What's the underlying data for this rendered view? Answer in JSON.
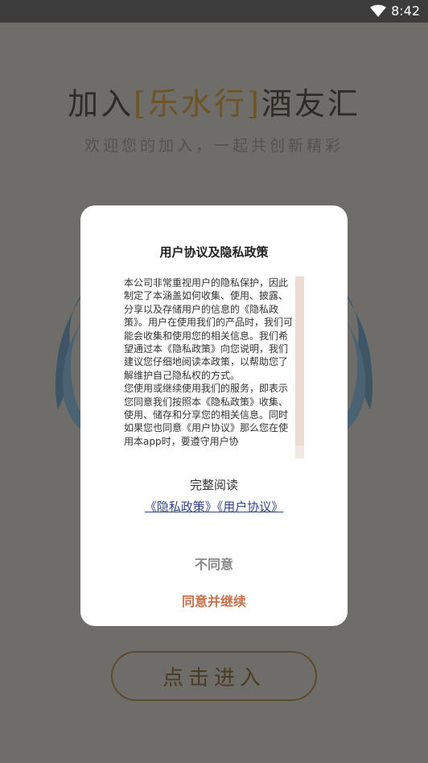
{
  "status_bar": {
    "time": "8:42"
  },
  "background": {
    "title_prefix": "加入",
    "bracket_open": "[",
    "brand": "乐水行",
    "bracket_close": "]",
    "title_suffix": "酒友汇",
    "subtitle": "欢迎您的加入，一起共创新精彩",
    "enter_button": "点击进入"
  },
  "dialog": {
    "title": "用户协议及隐私政策",
    "policy_paragraphs": [
      "本公司非常重视用户的隐私保护，因此制定了本涵盖如何收集、使用、披露、分享以及存储用户的信息的《隐私政策》。用户在使用我们的产品时，我们可能会收集和使用您的相关信息。我们希望通过本《隐私政策》向您说明，我们建议您仔细地阅读本政策，以帮助您了解维护自己隐私权的方式。",
      "您使用或继续使用我们的服务，即表示您同意我们按照本《隐私政策》收集、使用、储存和分享您的相关信息。同时如果您也同意《用户协议》那么您在使用本app时，要遵守用户协"
    ],
    "read_full_label": "完整阅读",
    "privacy_link": "《隐私政策》",
    "agreement_link": "《用户协议》",
    "disagree_label": "不同意",
    "agree_label": "同意并继续"
  },
  "colors": {
    "accent": "#c8734b",
    "link": "#334488",
    "overlay": "#6f6d6a"
  }
}
